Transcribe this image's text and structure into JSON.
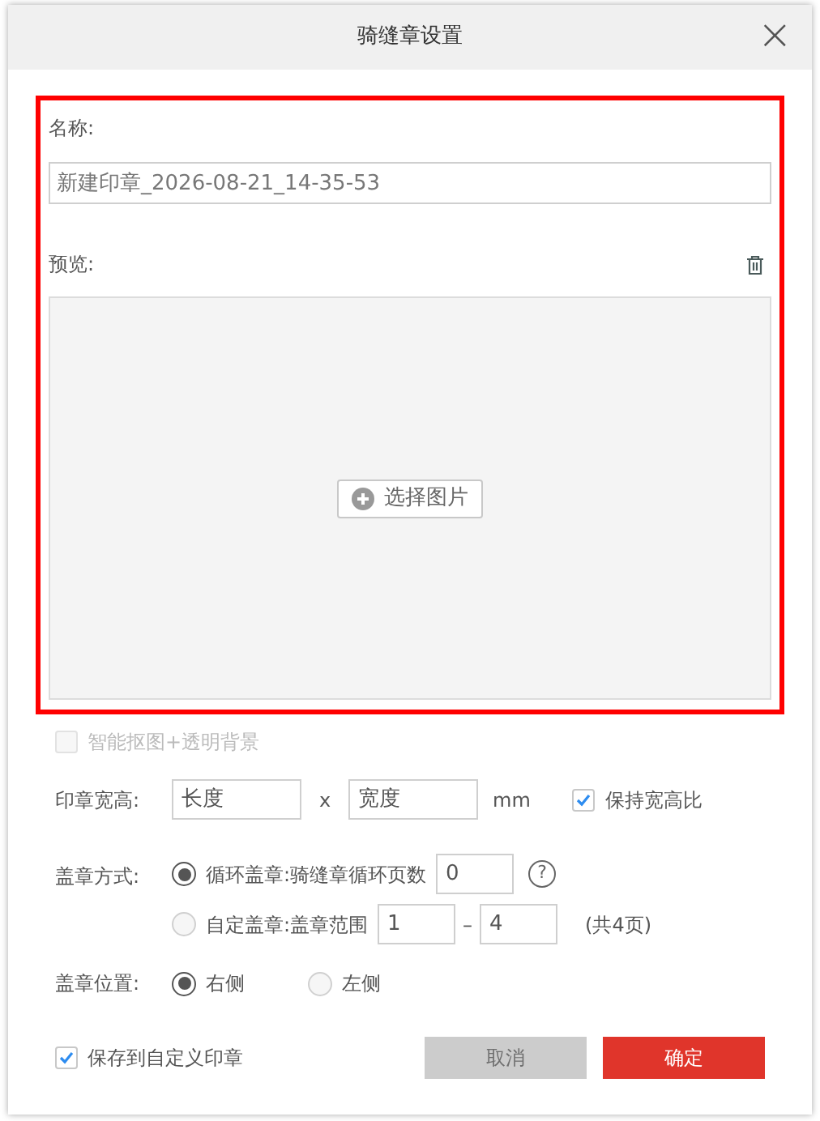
{
  "dialog": {
    "title": "骑缝章设置",
    "close": "×"
  },
  "name_field": {
    "label": "名称:",
    "value": "新建印章_2026-08-21_14-35-53"
  },
  "preview": {
    "label": "预览:",
    "button": "选择图片"
  },
  "smart_cutout": {
    "label": "智能抠图+透明背景",
    "checked": false,
    "disabled": true
  },
  "size": {
    "label": "印章宽高:",
    "width_placeholder": "长度",
    "separator": "x",
    "height_placeholder": "宽度",
    "unit": "mm",
    "keep_ratio": {
      "label": "保持宽高比",
      "checked": true
    }
  },
  "stamp_mode": {
    "label": "盖章方式:",
    "options": [
      {
        "label": "循环盖章:",
        "selected": true,
        "text": "骑缝章循环页数",
        "value": "0",
        "help": "?"
      },
      {
        "label": "自定盖章:",
        "selected": false,
        "text": "盖章范围",
        "from": "1",
        "dash": "–",
        "to": "4",
        "note": "(共4页)"
      }
    ]
  },
  "position": {
    "label": "盖章位置:",
    "options": [
      {
        "label": "右侧",
        "selected": true
      },
      {
        "label": "左侧",
        "selected": false
      }
    ]
  },
  "save_custom": {
    "label": "保存到自定义印章",
    "checked": true
  },
  "buttons": [
    {
      "label": "取消",
      "kind": "cancel",
      "disabled": true
    },
    {
      "label": "确定",
      "kind": "confirm",
      "disabled": false
    }
  ]
}
